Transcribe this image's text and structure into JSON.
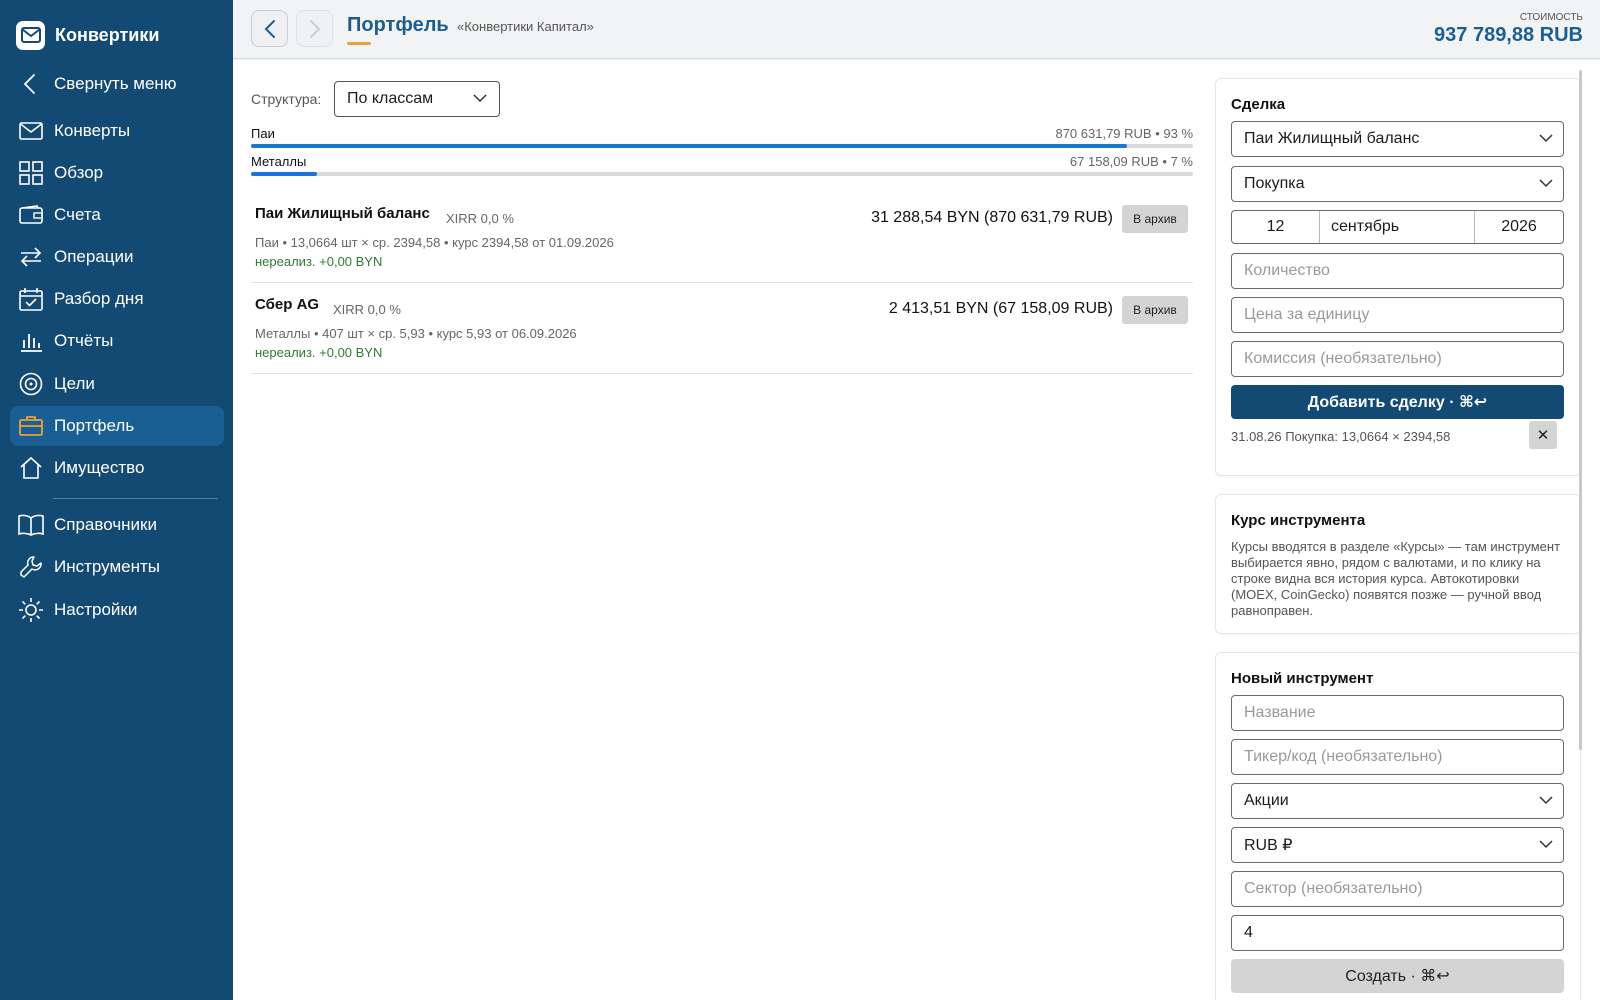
{
  "sidebar": {
    "brand": "Конвертики",
    "items": [
      {
        "label": "Свернуть меню",
        "icon": "chevron-left-icon"
      },
      {
        "label": "Конверты",
        "icon": "envelope-icon"
      },
      {
        "label": "Обзор",
        "icon": "grid-icon"
      },
      {
        "label": "Счета",
        "icon": "wallet-icon"
      },
      {
        "label": "Операции",
        "icon": "transfer-icon"
      },
      {
        "label": "Разбор дня",
        "icon": "calendar-check-icon"
      },
      {
        "label": "Отчёты",
        "icon": "bar-chart-icon"
      },
      {
        "label": "Цели",
        "icon": "target-icon"
      },
      {
        "label": "Портфель",
        "icon": "briefcase-icon",
        "active": true
      },
      {
        "label": "Имущество",
        "icon": "house-icon"
      },
      {
        "label": "Справочники",
        "icon": "book-icon"
      },
      {
        "label": "Инструменты",
        "icon": "wrench-icon"
      },
      {
        "label": "Настройки",
        "icon": "sun-gear-icon"
      }
    ]
  },
  "header": {
    "title": "Портфель",
    "subtitle": "«Конвертики Капитал»",
    "cost_label": "СТОИМОСТЬ",
    "cost_value": "937 789,88 RUB"
  },
  "main": {
    "structure_label": "Структура:",
    "structure_value": "По классам",
    "allocation": [
      {
        "name": "Паи",
        "value": "870 631,79 RUB • 93 %",
        "fraction": 0.93
      },
      {
        "name": "Металлы",
        "value": "67 158,09 RUB • 7 %",
        "fraction": 0.07
      }
    ],
    "positions": [
      {
        "name": "Паи Жилищный баланс",
        "xirr": "XIRR 0,0 %",
        "amount": "31 288,54 BYN (870 631,79 RUB)",
        "archive": "В архив",
        "detail": "Паи • 13,0664 шт × ср. 2394,58 • курс 2394,58 от 01.09.2026",
        "gain": "нереализ. +0,00 BYN"
      },
      {
        "name": "Сбер AG",
        "xirr": "XIRR 0,0 %",
        "amount": "2 413,51 BYN (67 158,09 RUB)",
        "archive": "В архив",
        "detail": "Металлы • 407 шт × ср. 5,93 • курс 5,93 от 06.09.2026",
        "gain": "нереализ. +0,00 BYN"
      }
    ]
  },
  "deal": {
    "title": "Сделка",
    "instrument": "Паи Жилищный баланс",
    "type": "Покупка",
    "date_day": "12",
    "date_month": "сентябрь",
    "date_year": "2026",
    "qty_placeholder": "Количество",
    "price_placeholder": "Цена за единицу",
    "fee_placeholder": "Комиссия (необязательно)",
    "add_button": "Добавить сделку · ⌘↩",
    "history": "31.08.26 Покупка: 13,0664 × 2394,58",
    "remove": "✕"
  },
  "course": {
    "title": "Курс инструмента",
    "text": "Курсы вводятся в разделе «Курсы» — там инструмент выбирается явно, рядом с валютами, и по клику на строке видна вся история курса. Автокотировки (MOEX, CoinGecko) появятся позже — ручной ввод равноправен."
  },
  "new_instrument": {
    "title": "Новый инструмент",
    "name_placeholder": "Название",
    "ticker_placeholder": "Тикер/код (необязательно)",
    "class_value": "Акции",
    "currency_value": "RUB ₽",
    "sector_placeholder": "Сектор (необязательно)",
    "decimals_value": "4",
    "create_button": "Создать · ⌘↩"
  },
  "colors": {
    "sidebar_bg": "#134a73",
    "active_item": "#1a5f93",
    "accent": "#1b5f92",
    "bar_fill": "#1976d2",
    "gain": "#2e7d32",
    "underline": "#e8a23a"
  }
}
